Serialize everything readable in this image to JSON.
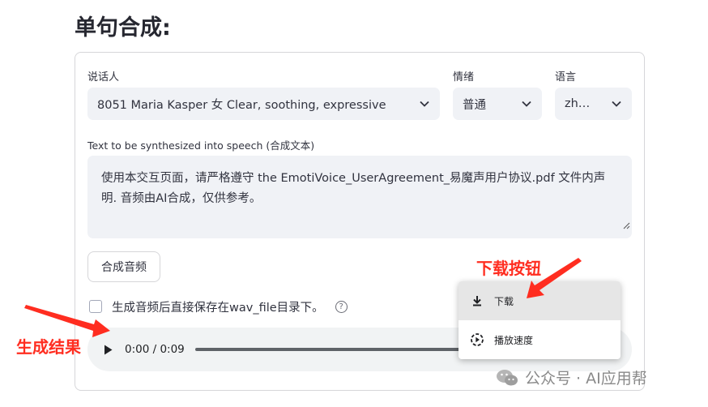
{
  "page_title": "单句合成:",
  "form": {
    "speaker": {
      "label": "说话人",
      "value": "8051 Maria Kasper 女 Clear, soothing, expressive"
    },
    "emotion": {
      "label": "情绪",
      "value": "普通"
    },
    "language": {
      "label": "语言",
      "value": "zh…"
    },
    "text": {
      "label": "Text to be synthesized into speech (合成文本)",
      "line1": "使用本交互页面，请严格遵守 the EmotiVoice_UserAgreement_易魔声用户协议.pdf 文件内声",
      "line2": "明. 音频由AI合成，仅供参考。"
    },
    "synthesize_button": "合成音频",
    "save_checkbox": {
      "label": "生成音频后直接保存在wav_file目录下。",
      "help": "?",
      "checked": false
    }
  },
  "audio_player": {
    "time": "0:00 / 0:09"
  },
  "context_menu": {
    "items": [
      {
        "label": "下载",
        "icon": "download-icon"
      },
      {
        "label": "播放速度",
        "icon": "playback-speed-icon"
      }
    ]
  },
  "annotations": {
    "download_button": "下载按钮",
    "result": "生成结果",
    "color": "#ff2d20"
  },
  "watermark": "公众号 · AI应用帮"
}
